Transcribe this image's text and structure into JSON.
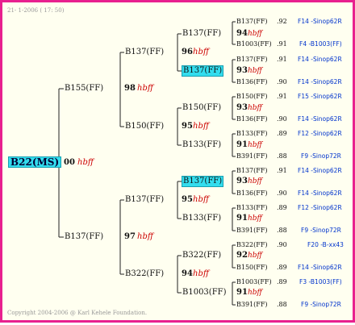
{
  "header": "21- 1-2006 ( 17: 50)",
  "footer": "Copyright 2004-2006 @ Karl Kehele Foundation.",
  "gen1": {
    "root": "B22(MS)",
    "score": "00",
    "code": "hbff"
  },
  "gen2": [
    {
      "name": "B155(FF)",
      "score": "98",
      "code": "hbff"
    },
    {
      "name": "B137(FF)",
      "score": "97",
      "code": "hbff"
    }
  ],
  "gen3": [
    {
      "name": "B137(FF)",
      "score": "96",
      "code": "hbff"
    },
    {
      "name": "B150(FF)",
      "score": "95",
      "code": "hbff"
    },
    {
      "name": "B137(FF)",
      "score": "95",
      "code": "hbff"
    },
    {
      "name": "B322(FF)",
      "score": "94",
      "code": "hbff"
    }
  ],
  "gen4": [
    {
      "name": "B137(FF)",
      "score": "94",
      "code": "hbff"
    },
    {
      "name": "B137(FF)",
      "score": "93",
      "code": "hbff"
    },
    {
      "name": "B150(FF)",
      "score": "93",
      "code": "hbff"
    },
    {
      "name": "B133(FF)",
      "score": "91",
      "code": "hbff"
    },
    {
      "name": "B137(FF)",
      "score": "93",
      "code": "hbff"
    },
    {
      "name": "B133(FF)",
      "score": "91",
      "code": "hbff"
    },
    {
      "name": "B322(FF)",
      "score": "92",
      "code": "hbff"
    },
    {
      "name": "B1003(FF)",
      "score": "91",
      "code": "hbff"
    }
  ],
  "gen5": [
    {
      "name": "B137(FF)",
      "num": ".92",
      "mate": "F14 -Sinop62R"
    },
    {
      "name": "B1003(FF)",
      "num": ".91",
      "mate": "F4 -B1003(FF)"
    },
    {
      "name": "B137(FF)",
      "num": ".91",
      "mate": "F14 -Sinop62R"
    },
    {
      "name": "B136(FF)",
      "num": ".90",
      "mate": "F14 -Sinop62R"
    },
    {
      "name": "B150(FF)",
      "num": ".91",
      "mate": "F15 -Sinop62R"
    },
    {
      "name": "B136(FF)",
      "num": ".90",
      "mate": "F14 -Sinop62R"
    },
    {
      "name": "B133(FF)",
      "num": ".89",
      "mate": "F12 -Sinop62R"
    },
    {
      "name": "B391(FF)",
      "num": ".88",
      "mate": "F9 -Sinop72R"
    },
    {
      "name": "B137(FF)",
      "num": ".91",
      "mate": "F14 -Sinop62R"
    },
    {
      "name": "B136(FF)",
      "num": ".90",
      "mate": "F14 -Sinop62R"
    },
    {
      "name": "B133(FF)",
      "num": ".89",
      "mate": "F12 -Sinop62R"
    },
    {
      "name": "B391(FF)",
      "num": ".88",
      "mate": "F9 -Sinop72R"
    },
    {
      "name": "B322(FF)",
      "num": ".90",
      "mate": "F20 -B-xx43"
    },
    {
      "name": "B150(FF)",
      "num": ".89",
      "mate": "F14 -Sinop62R"
    },
    {
      "name": "B1003(FF)",
      "num": ".89",
      "mate": "F3 -B1003(FF)"
    },
    {
      "name": "B391(FF)",
      "num": ".88",
      "mate": "F9 -Sinop72R"
    }
  ]
}
